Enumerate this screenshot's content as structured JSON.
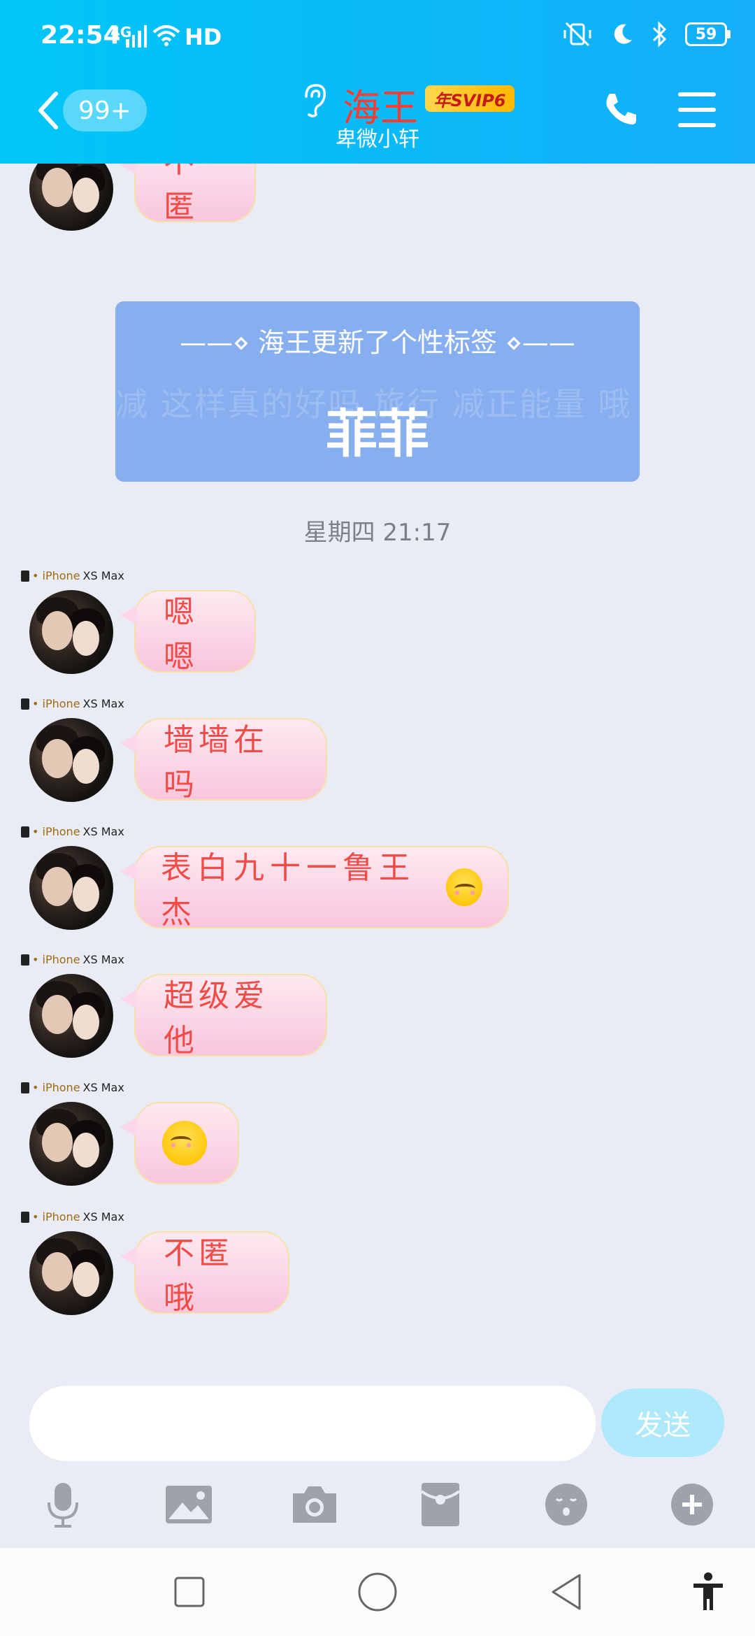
{
  "status_bar": {
    "time": "22:54",
    "network": "4G",
    "hd": "HD",
    "battery": "59"
  },
  "header": {
    "unread_count": "99+",
    "nickname": "海王",
    "badge": "年SVIP6",
    "subtitle": "卑微小轩"
  },
  "signature_card": {
    "header": "——⋄ 海王更新了个性标签 ⋄——",
    "value": "菲菲",
    "background_words": "减 这样真的好吗 旅行 减正能量 哦 肥 不成熟的小建 爱咋咋地 肥燥燥燥起来"
  },
  "timestamp": "星期四 21:17",
  "device": {
    "brand": "• iPhone ",
    "model": "XS Max"
  },
  "messages": [
    {
      "text": "不匿",
      "emoji": false
    },
    {
      "text": "嗯嗯",
      "emoji": false
    },
    {
      "text": "墙墙在吗",
      "emoji": false
    },
    {
      "text": "表白九十一鲁王杰",
      "emoji": true
    },
    {
      "text": "超级爱他",
      "emoji": false
    },
    {
      "text": "",
      "emoji": true
    },
    {
      "text": "不匿哦",
      "emoji": false
    }
  ],
  "input_bar": {
    "placeholder": "",
    "send_label": "发送"
  },
  "colors": {
    "header_gradient_start": "#00c6f7",
    "header_gradient_end": "#14aef9",
    "nickname": "#ff3b30",
    "bubble_text": "#ef4c48",
    "sign_card": "#87aff0",
    "send_button": "#aee8fb"
  },
  "icons": {
    "header": [
      "back-arrow-icon",
      "ear-icon",
      "phone-icon",
      "menu-icon"
    ],
    "toolbar": [
      "microphone-icon",
      "image-icon",
      "camera-icon",
      "red-packet-icon",
      "emoji-icon",
      "plus-icon"
    ],
    "navbar": [
      "recent-apps-icon",
      "home-icon",
      "back-icon",
      "accessibility-icon"
    ]
  }
}
